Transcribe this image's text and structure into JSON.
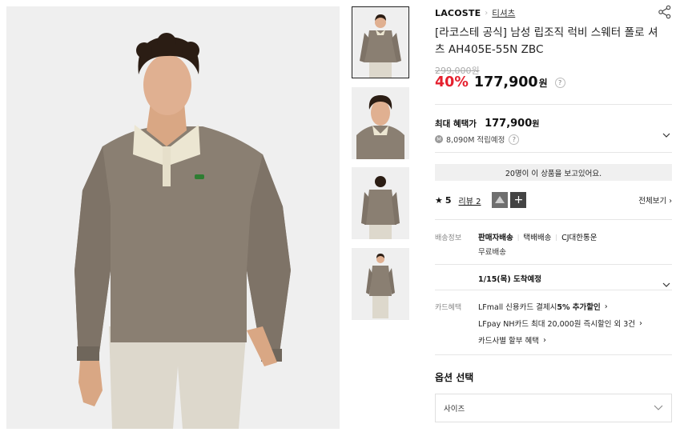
{
  "breadcrumb": {
    "brand": "LACOSTE",
    "separator": "›",
    "category": "티셔츠"
  },
  "product": {
    "title": "[라코스테 공식] 남성 립조직 럭비 스웨터 폴로 셔츠 AH405E-55N ZBC",
    "original_price": "299,000원",
    "discount": "40%",
    "price": "177,900",
    "currency": "원",
    "help_mark": "?"
  },
  "benefit": {
    "label": "최대 혜택가",
    "amount": "177,900",
    "currency": "원",
    "points": "8,090M 적립예정",
    "points_icon": "M",
    "help_mark": "?"
  },
  "viewing_notice": "20명이 이 상품을 보고있어요.",
  "reviews": {
    "star": "★",
    "rating": "5",
    "link_label": "리뷰 2",
    "more_symbol": "+",
    "see_all": "전체보기 ›"
  },
  "shipping": {
    "label": "배송정보",
    "method": "판매자배송",
    "type": "택배배송",
    "carrier": "CJ대한통운",
    "fee": "무료배송",
    "arrival": "1/15(목) 도착예정"
  },
  "card": {
    "label": "카드혜택",
    "line1_prefix": "LFmall 신용카드 결제시 ",
    "line1_bold": "5% 추가할인",
    "line2": "LFpay NH카드 최대 20,000원 즉시할인 외 3건",
    "line3": "카드사별 할부 혜택",
    "arrow": "›"
  },
  "options": {
    "title": "옵션 선택",
    "size_placeholder": "사이즈"
  },
  "icons": {
    "share": "share-icon",
    "chevron": "chevron-down-icon",
    "star": "star-icon"
  },
  "colors": {
    "sale": "#e5202e",
    "sweater": "#8a7f72",
    "collar": "#ece6d2",
    "bg": "#efefef"
  }
}
